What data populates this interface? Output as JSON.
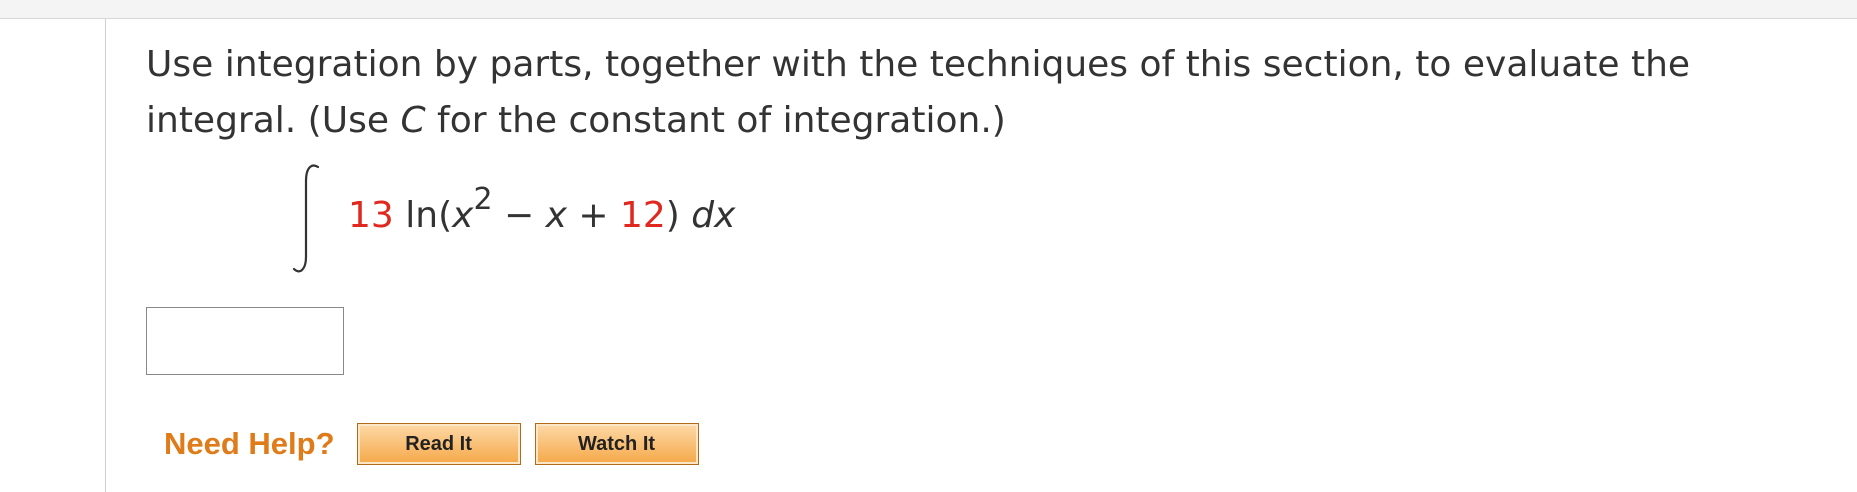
{
  "question": {
    "instruction_line1": "Use integration by parts, together with the techniques of this section, to evaluate the",
    "instruction_line2_prefix": "integral. (Use ",
    "instruction_var": "C",
    "instruction_line2_suffix": " for the constant of integration.)"
  },
  "integral": {
    "coefficient": "13",
    "func_prefix": " ln(",
    "var_x": "x",
    "exponent": "2",
    "minus": " − ",
    "var_x2": "x",
    "plus": " + ",
    "constant": "12",
    "close": ") ",
    "differential": "dx"
  },
  "answer": {
    "value": ""
  },
  "help": {
    "label": "Need Help?",
    "read_it": "Read It",
    "watch_it": "Watch It"
  },
  "colors": {
    "highlight": "#e0281e",
    "help_label": "#e07b1a",
    "button_fill": "#f5a847"
  }
}
